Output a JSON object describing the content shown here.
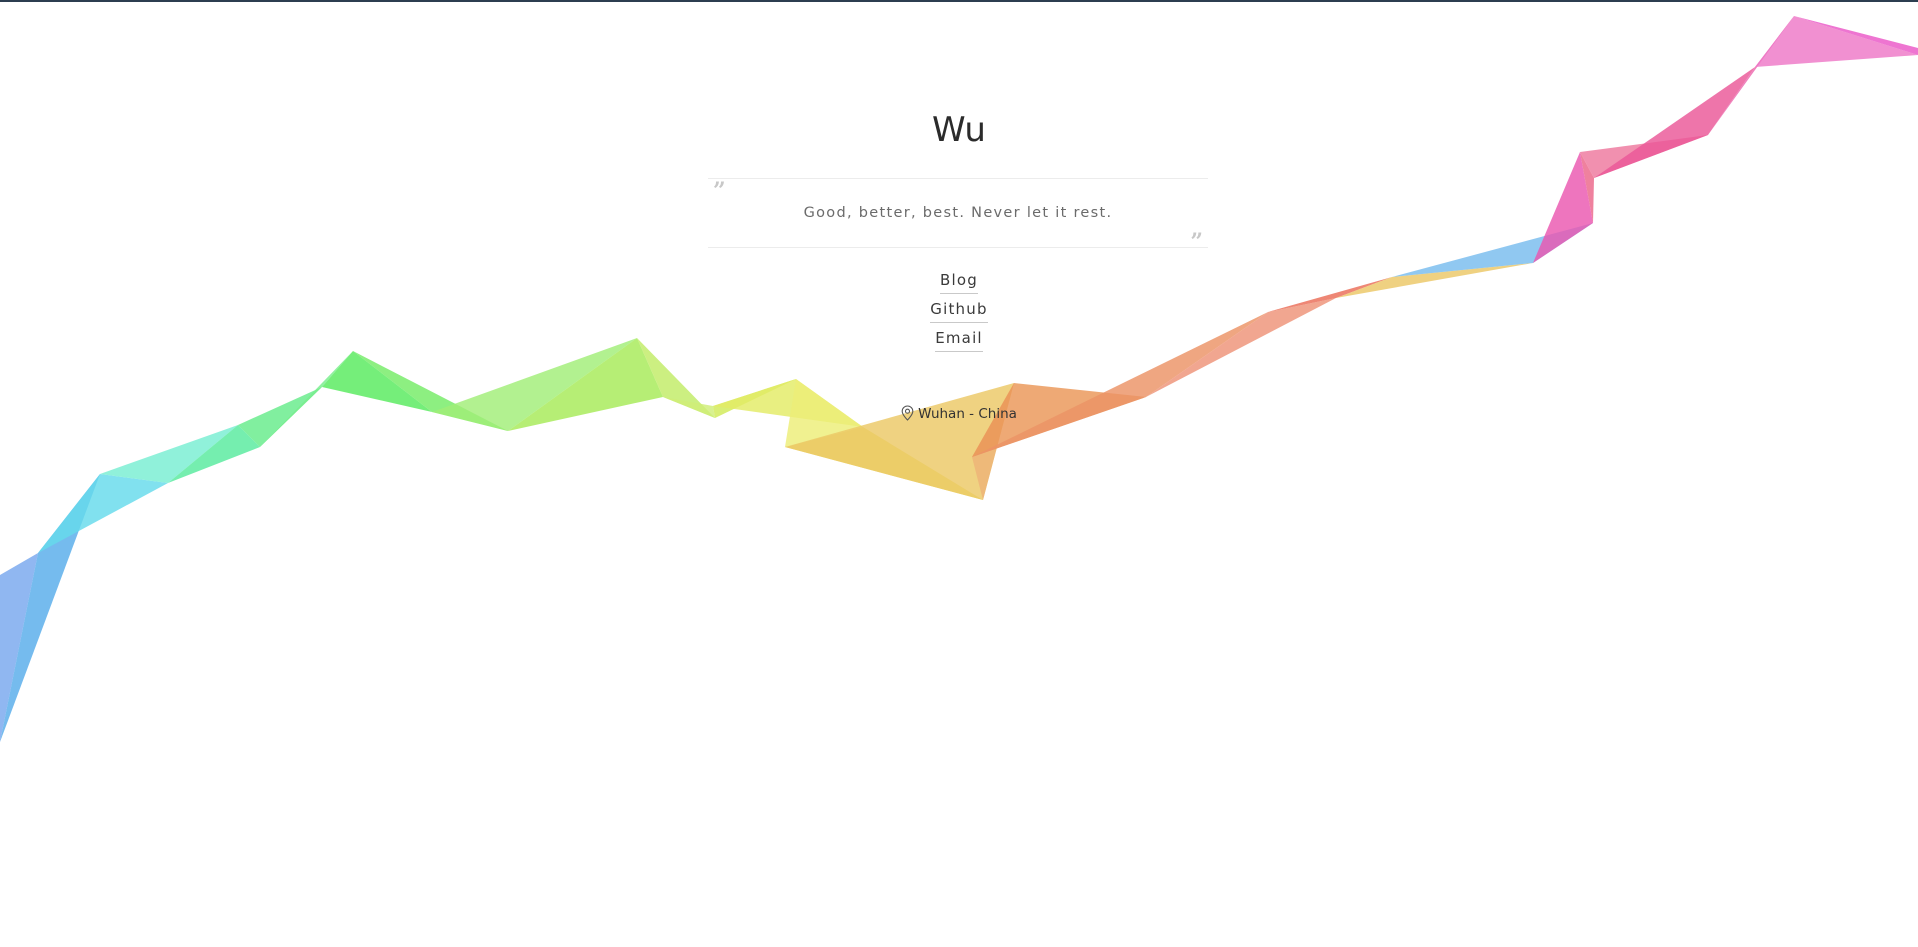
{
  "profile": {
    "name": "Wu",
    "motto": "Good, better, best. Never let it rest.",
    "location": "Wuhan - China"
  },
  "links": [
    {
      "label": "Blog",
      "name": "blog-link"
    },
    {
      "label": "Github",
      "name": "github-link"
    },
    {
      "label": "Email",
      "name": "email-link"
    }
  ],
  "icons": {
    "quote_open": "quote-open-icon",
    "quote_close": "quote-close-icon",
    "location": "map-pin-icon"
  },
  "colors": {
    "top_bar": "#2c3e50",
    "ribbon_start": "#6f9be8",
    "ribbon_green": "#8ff068",
    "ribbon_orange": "#e28a43",
    "ribbon_red": "#e94f6d",
    "ribbon_end": "#d04ac0"
  }
}
